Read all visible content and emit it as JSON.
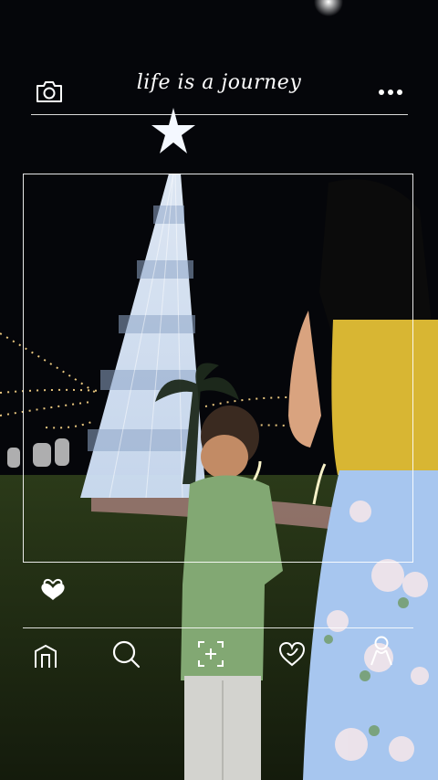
{
  "header": {
    "title": "life is a journey",
    "camera_icon": "camera-icon",
    "menu_icon": "more-dots-icon"
  },
  "overlay": {
    "like_icon": "heart-icon"
  },
  "bottom_nav": {
    "items": [
      {
        "icon": "home-icon"
      },
      {
        "icon": "search-icon"
      },
      {
        "icon": "add-post-icon"
      },
      {
        "icon": "heart-outline-icon"
      },
      {
        "icon": "profile-icon"
      }
    ]
  },
  "colors": {
    "sky": "#05060a",
    "grass": "#1d2a12",
    "dress": "#9fc3ef",
    "top": "#d6b52e",
    "shirt": "#7fa66c",
    "lights": "#ffe9a8"
  }
}
